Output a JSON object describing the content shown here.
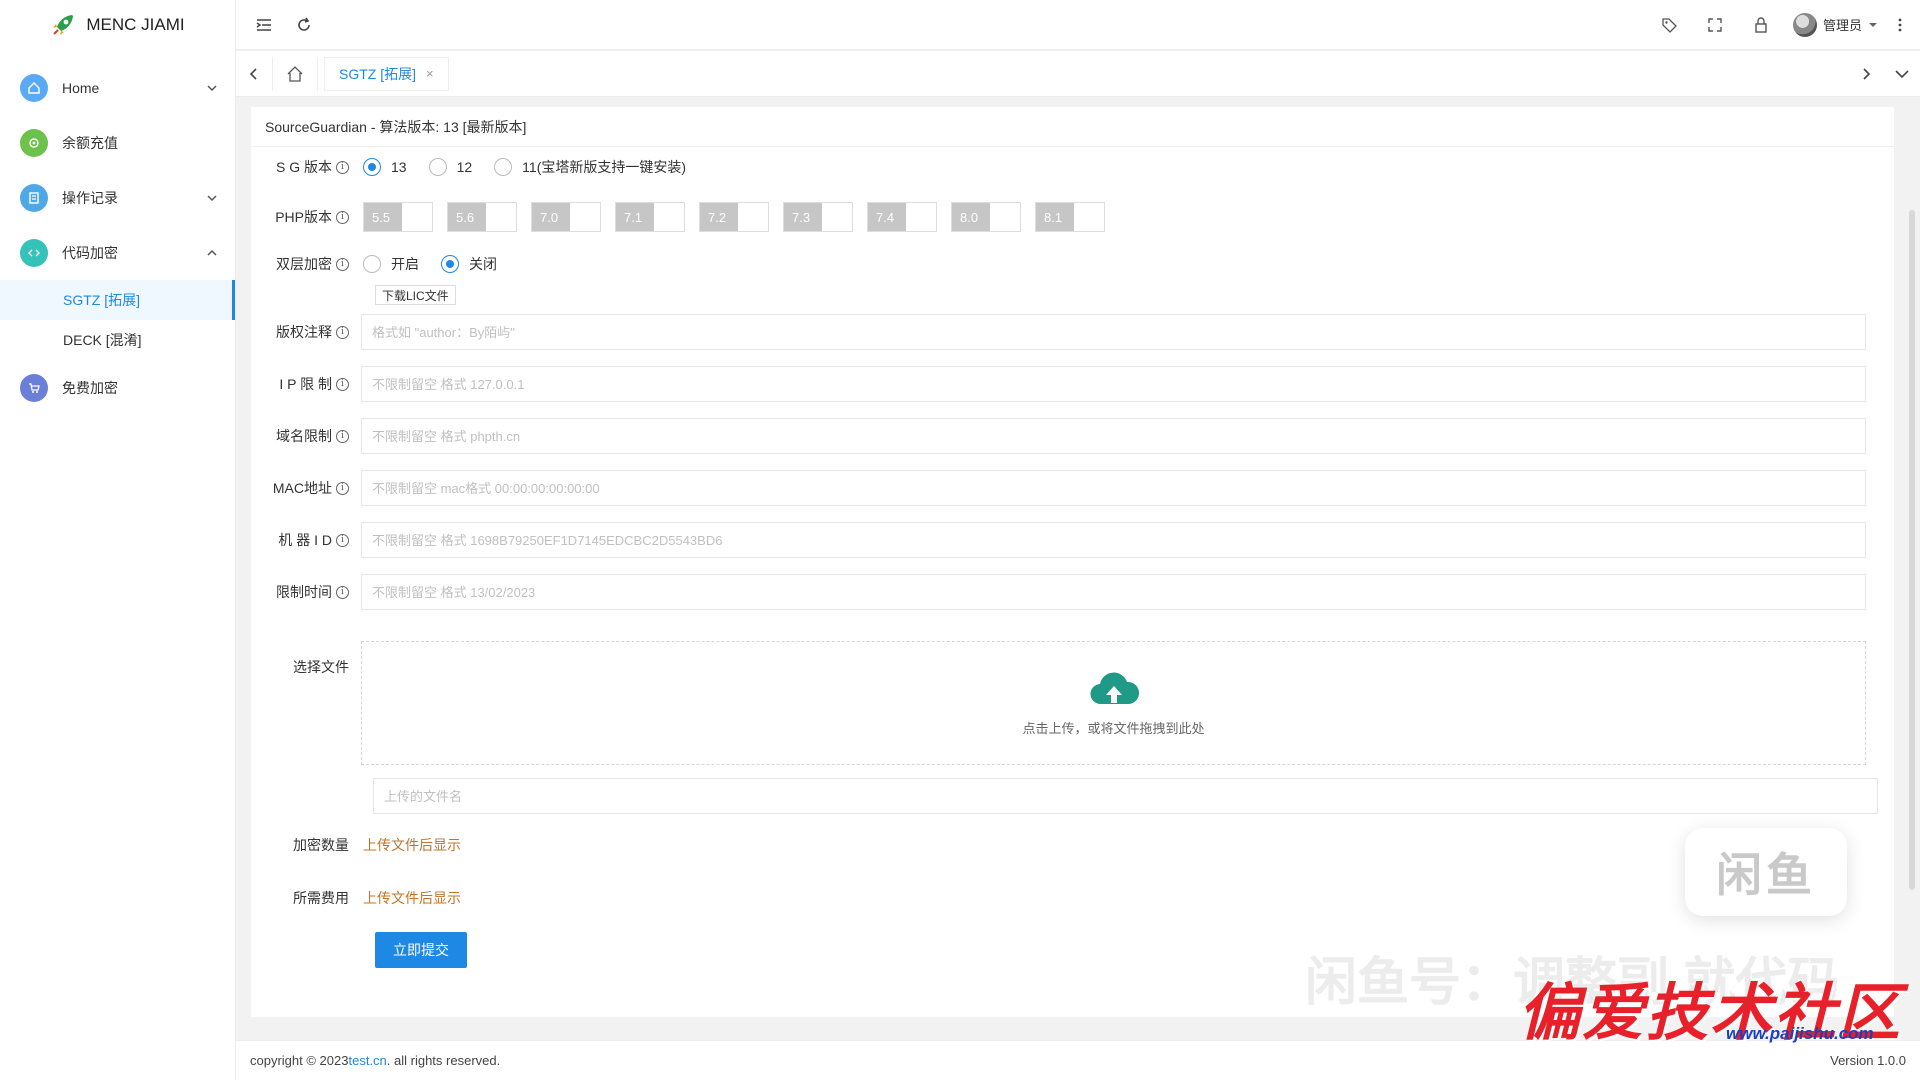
{
  "app": {
    "title": "MENC JIAMI"
  },
  "sidebar": {
    "items": [
      {
        "label": "Home",
        "icon": "home-icon",
        "color": "#5aa9f5",
        "arrow": "down"
      },
      {
        "label": "余额充值",
        "icon": "wallet-icon",
        "color": "#6cc24a",
        "arrow": ""
      },
      {
        "label": "操作记录",
        "icon": "record-icon",
        "color": "#4ea8e8",
        "arrow": "down"
      },
      {
        "label": "代码加密",
        "icon": "code-icon",
        "color": "#35c2b9",
        "arrow": "up"
      }
    ],
    "subitems": [
      {
        "label": "SGTZ [拓展]",
        "active": true
      },
      {
        "label": "DECK [混淆]",
        "active": false
      }
    ],
    "last_item": {
      "label": "免费加密",
      "icon": "cart-icon",
      "color": "#6a7fd8"
    }
  },
  "header": {
    "user": "管理员"
  },
  "tabs": [
    {
      "label": "SGTZ [拓展]",
      "close": "×"
    }
  ],
  "card": {
    "title": "SourceGuardian - 算法版本: 13 [最新版本]"
  },
  "form": {
    "sg_version": {
      "label": "S G 版本",
      "options": [
        "13",
        "12",
        "11(宝塔新版支持一键安装)"
      ],
      "selected": "13"
    },
    "php_version": {
      "label": "PHP版本",
      "options": [
        "5.5",
        "5.6",
        "7.0",
        "7.1",
        "7.2",
        "7.3",
        "7.4",
        "8.0",
        "8.1"
      ]
    },
    "double_encrypt": {
      "label": "双层加密",
      "options": [
        "开启",
        "关闭"
      ],
      "selected": "关闭",
      "download_label": "下载LIC文件"
    },
    "copyright": {
      "label": "版权注释",
      "placeholder": "格式如 \"author：By陌屿\""
    },
    "ip_limit": {
      "label": "I P 限 制",
      "placeholder": "不限制留空 格式 127.0.0.1"
    },
    "domain_limit": {
      "label": "域名限制",
      "placeholder": "不限制留空 格式 phpth.cn"
    },
    "mac": {
      "label": "MAC地址",
      "placeholder": "不限制留空 mac格式 00:00:00:00:00:00"
    },
    "machine_id": {
      "label": "机 器 I D",
      "placeholder": "不限制留空 格式 1698B79250EF1D7145EDCBC2D5543BD6"
    },
    "time_limit": {
      "label": "限制时间",
      "placeholder": "不限制留空 格式 13/02/2023"
    },
    "file": {
      "label": "选择文件",
      "hint": "点击上传，或将文件拖拽到此处",
      "filename_placeholder": "上传的文件名"
    },
    "count": {
      "label": "加密数量",
      "value": "上传文件后显示"
    },
    "fee": {
      "label": "所需费用",
      "value": "上传文件后显示"
    },
    "submit_label": "立即提交"
  },
  "footer": {
    "copyright_prefix": "copyright © 2023 ",
    "link": "test.cn",
    "copyright_suffix": ". all rights reserved.",
    "version": "Version 1.0.0"
  },
  "watermark": {
    "badge": "闲鱼",
    "text": "闲鱼号：调整副 就代码",
    "brand": "偏爱技术社区",
    "url": "www.paijishu.com"
  },
  "colors": {
    "accent": "#1e88e5",
    "note": "#c0752a",
    "upload_icon": "#1f9a86"
  }
}
